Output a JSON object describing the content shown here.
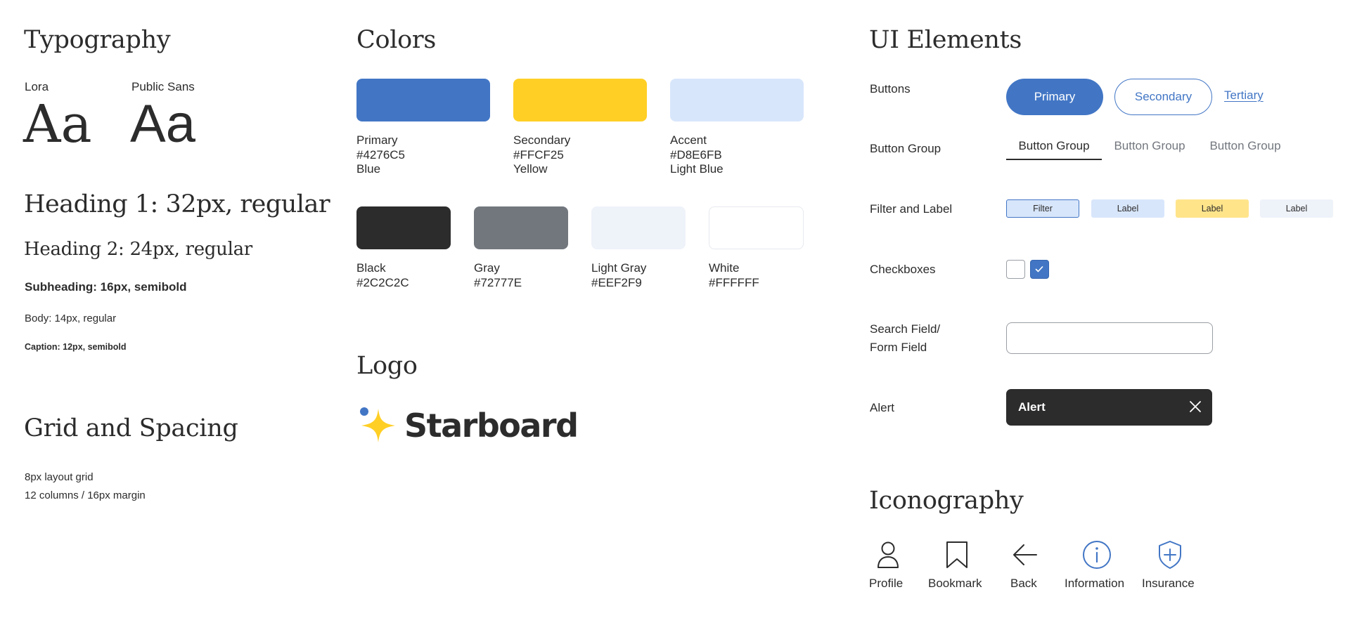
{
  "typography": {
    "title": "Typography",
    "fonts": [
      {
        "name": "Lora",
        "sample": "Aa"
      },
      {
        "name": "Public Sans",
        "sample": "Aa"
      }
    ],
    "heading1": "Heading 1: 32px, regular",
    "heading2": "Heading 2: 24px, regular",
    "subheading": "Subheading: 16px, semibold",
    "body": "Body: 14px, regular",
    "caption": "Caption: 12px, semibold"
  },
  "grid": {
    "title": "Grid and Spacing",
    "lines": [
      "8px layout grid",
      "12 columns / 16px margin"
    ]
  },
  "colors": {
    "title": "Colors",
    "swatches": [
      {
        "name": "Primary",
        "hex": "#4276C5",
        "desc": "Blue"
      },
      {
        "name": "Secondary",
        "hex": "#FFCF25",
        "desc": "Yellow"
      },
      {
        "name": "Accent",
        "hex": "#D8E6FB",
        "desc": "Light Blue"
      },
      {
        "name": "Black",
        "hex": "#2C2C2C"
      },
      {
        "name": "Gray",
        "hex": "#72777E"
      },
      {
        "name": "Light Gray",
        "hex": "#EEF2F9"
      },
      {
        "name": "White",
        "hex": "#FFFFFF"
      }
    ]
  },
  "logo": {
    "title": "Logo",
    "wordmark": "Starboard"
  },
  "ui": {
    "title": "UI Elements",
    "buttons_label": "Buttons",
    "primary": "Primary",
    "secondary": "Secondary",
    "tertiary": "Tertiary",
    "button_group_label": "Button Group",
    "button_group": [
      "Button Group",
      "Button Group",
      "Button Group"
    ],
    "filter_label_label": "Filter and Label",
    "filter": "Filter",
    "labels": [
      "Label",
      "Label",
      "Label"
    ],
    "checkboxes_label": "Checkboxes",
    "checkbox_states": [
      false,
      true
    ],
    "search_label_line1": "Search Field/",
    "search_label_line2": "Form Field",
    "search_value": "",
    "alert_label": "Alert",
    "alert_text": "Alert"
  },
  "iconography": {
    "title": "Iconography",
    "icons": [
      {
        "label": "Profile",
        "icon": "profile-icon"
      },
      {
        "label": "Bookmark",
        "icon": "bookmark-icon"
      },
      {
        "label": "Back",
        "icon": "back-arrow-icon"
      },
      {
        "label": "Information",
        "icon": "information-icon"
      },
      {
        "label": "Insurance",
        "icon": "insurance-shield-icon"
      }
    ]
  },
  "theme": {
    "primary": "#4276C5",
    "secondary": "#FFCF25",
    "accent": "#D8E6FB",
    "black": "#2C2C2C",
    "gray": "#72777E",
    "light_gray": "#EEF2F9",
    "white": "#FFFFFF",
    "label_yellow": "#FFE48A"
  }
}
